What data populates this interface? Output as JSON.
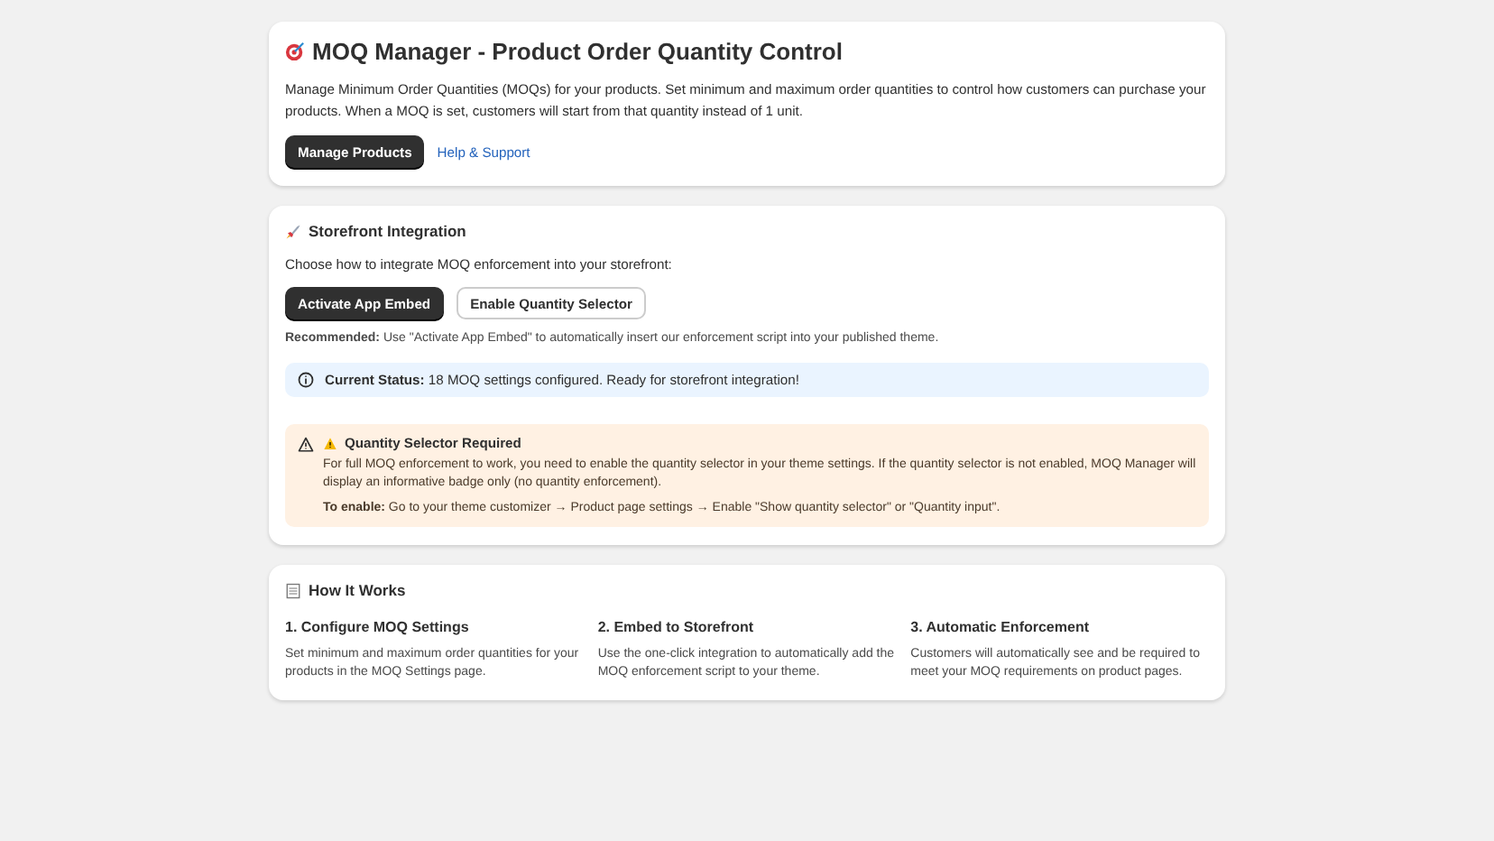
{
  "header": {
    "title": "MOQ Manager - Product Order Quantity Control",
    "description": "Manage Minimum Order Quantities (MOQs) for your products. Set minimum and maximum order quantities to control how customers can purchase your products. When a MOQ is set, customers will start from that quantity instead of 1 unit.",
    "primary_button": "Manage Products",
    "link": "Help & Support"
  },
  "storefront": {
    "title": "Storefront Integration",
    "intro": "Choose how to integrate MOQ enforcement into your storefront:",
    "buttons": [
      {
        "label": "Activate App Embed",
        "kind": "primary"
      },
      {
        "label": "Enable Quantity Selector",
        "kind": "secondary"
      }
    ],
    "recommendation": "**Recommended:** Use \"Activate App Embed\" to automatically insert our enforcement script into your published theme.",
    "status": "**Current Status:** 18 MOQ settings configured. Ready for storefront integration!",
    "warning": {
      "title": "Quantity Selector Required",
      "body": "For full MOQ enforcement to work, you need to enable the quantity selector in your theme settings. If the quantity selector is not enabled, MOQ Manager will display an informative badge only (no quantity enforcement).",
      "steps": "**To enable:** Go to your theme customizer → Product page settings → Enable \"Show quantity selector\" or \"Quantity input\"."
    }
  },
  "how_it_works": {
    "title": "How It Works",
    "steps": [
      {
        "title": "1. Configure MOQ Settings",
        "text": "Set minimum and maximum order quantities for your products in the MOQ Settings page."
      },
      {
        "title": "2. Embed to Storefront",
        "text": "Use the one-click integration to automatically add the MOQ enforcement script to your theme."
      },
      {
        "title": "3. Automatic Enforcement",
        "text": "Customers will automatically see and be required to meet your MOQ requirements on product pages."
      }
    ]
  }
}
